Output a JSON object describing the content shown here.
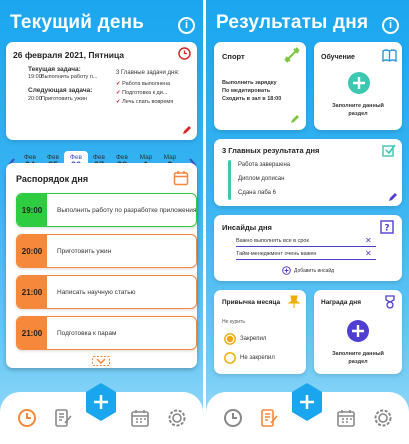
{
  "left": {
    "title": "Текущий день",
    "date_card": {
      "date": "26 февраля 2021, Пятница",
      "current_label": "Текущая задача:",
      "current_time": "19:00",
      "current_text": "Выполнить работу п...",
      "next_label": "Следующая задача:",
      "next_time": "20:00",
      "next_text": "Приготовить ужин",
      "main_label": "3 Главные задачи дня:",
      "main_tasks": [
        "Работа выполнена",
        "Подготовка к ди...",
        "Лечь спать вовремя"
      ]
    },
    "days": [
      {
        "m": "Фев",
        "d": "24",
        "w": "Ср"
      },
      {
        "m": "Фев",
        "d": "25",
        "w": "Чт"
      },
      {
        "m": "Фев",
        "d": "26",
        "w": "Пт"
      },
      {
        "m": "Фев",
        "d": "27",
        "w": "Сб"
      },
      {
        "m": "Фев",
        "d": "28",
        "w": "Вс"
      },
      {
        "m": "Мар",
        "d": "1",
        "w": "Пн"
      },
      {
        "m": "Мар",
        "d": "2",
        "w": "Вт"
      }
    ],
    "schedule_title": "Распорядок дня",
    "tasks": [
      {
        "time": "19:00",
        "text": "Выполнить работу по разработке приложения",
        "color": "#2ecc40"
      },
      {
        "time": "20:00",
        "text": "Приготовить ужин",
        "color": "#f5883a"
      },
      {
        "time": "21:00",
        "text": "Написать научную статью",
        "color": "#f5883a"
      },
      {
        "time": "21:00",
        "text": "Подготовка к парам",
        "color": "#f5883a"
      }
    ]
  },
  "right": {
    "title": "Результаты дня",
    "sport": {
      "title": "Спорт",
      "items": [
        "Выполнить зарядку",
        "По медитировать",
        "Сходить в зал в 18:00"
      ]
    },
    "study": {
      "title": "Обучение",
      "text": "Заполните данный раздел"
    },
    "results": {
      "title": "3 Главных результата дня",
      "items": [
        "Работа завершена",
        "Диплом дописан",
        "Сдана лаба 6"
      ]
    },
    "insights": {
      "title": "Инсайды дня",
      "items": [
        "Важно выполнять все в срок",
        "Тайм-менеджмент очень важен"
      ],
      "add_label": "Добавить инсайд"
    },
    "habit": {
      "title": "Привычка месяца",
      "subtitle": "Не курить",
      "opt1": "Закрепил",
      "opt2": "Не закрепил"
    },
    "award": {
      "title": "Награда дня",
      "text": "Заполните данный раздел"
    }
  },
  "colors": {
    "accent": "#1aa6ef",
    "orange": "#f5883a",
    "green": "#2ecc40",
    "purple": "#4f3fd0",
    "teal": "#3cc7b0"
  }
}
